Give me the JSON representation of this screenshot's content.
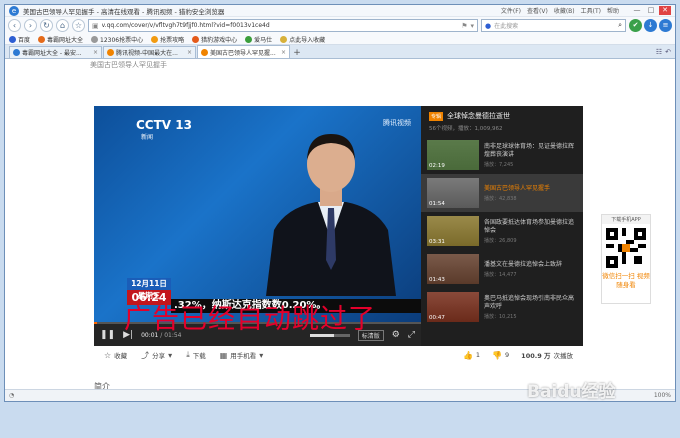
{
  "window": {
    "title": "美国古巴领导人罕见握手 - 高清在线观看 - 腾讯视频 - 猎豹安全浏览器",
    "menus": [
      "文件(F)",
      "查看(V)",
      "收藏(B)",
      "工具(T)",
      "帮助"
    ],
    "controls": [
      "—",
      "□",
      "✕"
    ]
  },
  "nav": {
    "url": "v.qq.com/cover/v/vfltvgh7t9fjjf0.html?vid=f0013v1ce4d",
    "search_placeholder": "在此搜索",
    "icons": [
      "back-icon",
      "forward-icon",
      "refresh-icon",
      "home-icon",
      "star-icon"
    ]
  },
  "favorites": [
    {
      "label": "百度",
      "color": "#2d5ed3"
    },
    {
      "label": "毒霸网址大全",
      "color": "#e46a1a"
    },
    {
      "label": "12306抢票中心",
      "color": "#999999"
    },
    {
      "label": "抢票攻略",
      "color": "#f29b11"
    },
    {
      "label": "猎豹游戏中心",
      "color": "#e45a1a"
    },
    {
      "label": "爱马仕",
      "color": "#3b9e3b"
    },
    {
      "label": "点此导入收藏",
      "color": "#d8b13a"
    }
  ],
  "tabs": [
    {
      "label": "毒霸网址大全 - 最安...",
      "color": "#2d7ad3",
      "active": false
    },
    {
      "label": "腾讯视频-中国最大在...",
      "color": "#f08300",
      "active": false
    },
    {
      "label": "美国古巴领导人罕见握...",
      "color": "#f08300",
      "active": true
    }
  ],
  "page": {
    "title": "美国古巴领导人罕见握手"
  },
  "video": {
    "channel": "CCTV 13",
    "channel_sub": "新闻",
    "tencent_logo": "腾讯视频",
    "date": "12月11日 星期三",
    "clock": "06:24",
    "ticker": ".32%，纳斯达克指数数0.20%。",
    "time_current": "00:01",
    "time_total": "01:54",
    "progress": 0.01,
    "volume": 0.6,
    "quality": "标清版"
  },
  "playlist": {
    "tag": "专辑",
    "title": "全球悼念曼德拉逝世",
    "meta": "56个视频，播放：1,009,962",
    "items": [
      {
        "title": "南非足球球体育场：见证曼德拉辉煌葬丧演讲",
        "plays": "播放：7,245",
        "duration": "02:19",
        "color": "#4a6a3a",
        "active": false
      },
      {
        "title": "美国古巴领导人罕见握手",
        "plays": "播放：42,838",
        "duration": "01:54",
        "color": "#6a6a6a",
        "active": true
      },
      {
        "title": "各国政要抵达体育场参加曼德拉追悼会",
        "plays": "播放：26,809",
        "duration": "03:31",
        "color": "#8a7a3a",
        "active": false
      },
      {
        "title": "潘基文在曼德拉追悼会上致辞",
        "plays": "播放：14,477",
        "duration": "01:43",
        "color": "#6a4a3a",
        "active": false
      },
      {
        "title": "奥巴马抵追悼会现场引南非民众高声欢呼",
        "plays": "播放：10,215",
        "duration": "00:47",
        "color": "#7a3a2a",
        "active": false
      }
    ]
  },
  "actions": {
    "favorite": "收藏",
    "share": "分享",
    "download": "下载",
    "mobile": "用手机看",
    "like_count": "1",
    "dislike_count": "9",
    "views": "100.9 万",
    "views_suffix": "次播放"
  },
  "intro_label": "简介",
  "overlay_text": "广告已经自动跳过了",
  "qr": {
    "header": "下载手机APP",
    "caption": "微信扫一扫 视频随身看"
  },
  "status": {
    "zoom": "100%"
  },
  "watermark": "Baidu经验"
}
